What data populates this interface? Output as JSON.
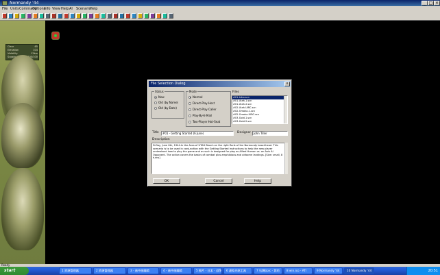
{
  "window": {
    "title": "Normandy '44"
  },
  "menu": [
    "File",
    "Units",
    "Command",
    "Options",
    "Info",
    "View",
    "Help",
    "AI",
    "Scenario",
    "Help"
  ],
  "left_panel": {
    "stats": [
      {
        "label": "Clear",
        "value": "65"
      },
      {
        "label": "Elevation",
        "value": "104"
      },
      {
        "label": "Visibility",
        "value": "12km"
      },
      {
        "label": "Supply",
        "value": "100/100"
      }
    ]
  },
  "dialog": {
    "title": "File Selection Dialog",
    "close_label": "x",
    "status": {
      "label": "Status",
      "options": [
        {
          "label": "New",
          "selected": true
        },
        {
          "label": "Old (by Name)",
          "selected": false
        },
        {
          "label": "Old (by Date)",
          "selected": false
        }
      ]
    },
    "mode": {
      "label": "Mode",
      "options": [
        {
          "label": "Normal",
          "selected": true
        },
        {
          "label": "Direct-Play Host",
          "selected": false
        },
        {
          "label": "Direct-Play Caller",
          "selected": false
        },
        {
          "label": "Play-By-E-Mail",
          "selected": false
        },
        {
          "label": "Two-Player Hot-Seat",
          "selected": false
        }
      ]
    },
    "files": {
      "label": "Files",
      "items": [
        "#01-Intro.scn",
        "#01-Utah-1.scn",
        "#01-Utah-2.scn",
        "#02-Utah-UIRC.scn",
        "#02-Omaha-1.scn",
        "#02-Omaha-UIRC.scn",
        "#03-Gold-1.scn",
        "#03-Gold-2.scn"
      ],
      "selected_index": 0
    },
    "title_label": "Title",
    "title_value": "#01 - Getting Started (6 June)",
    "designer_label": "Designer",
    "designer_value": "John Tiller",
    "description_label": "Description",
    "description": "D-Day, June 6th, 1944.In the Area of UTAH Beach on the right flank of the Normandy beachhead. This scenario is to be used in conjunction with the Getting Started instructions to help the new player understand how to play the game and as such is designed for play as Allied Human vs. an Axis AI Opponent. The action covers the basics of combat plus amphibious and airborne landings. [Size: small, 8 turns]",
    "buttons": {
      "ok": "OK",
      "cancel": "Cancel",
      "help": "Help"
    }
  },
  "status_bar": {
    "text": "Ready"
  },
  "taskbar": {
    "start": "start",
    "tasks": [
      "1 资源管理器",
      "2 资源管理器",
      "3 - 画中画编辑",
      "4 - 画中画编辑",
      "5 图片 - 日本 - 战争",
      "6 虚拟光驱工具",
      "7 \\战略\\pic - 我的",
      "8 win.ico - ATI",
      "9 Normandy '44",
      "10 Normandy '44"
    ],
    "active_index": 9,
    "clock": "20:51"
  }
}
